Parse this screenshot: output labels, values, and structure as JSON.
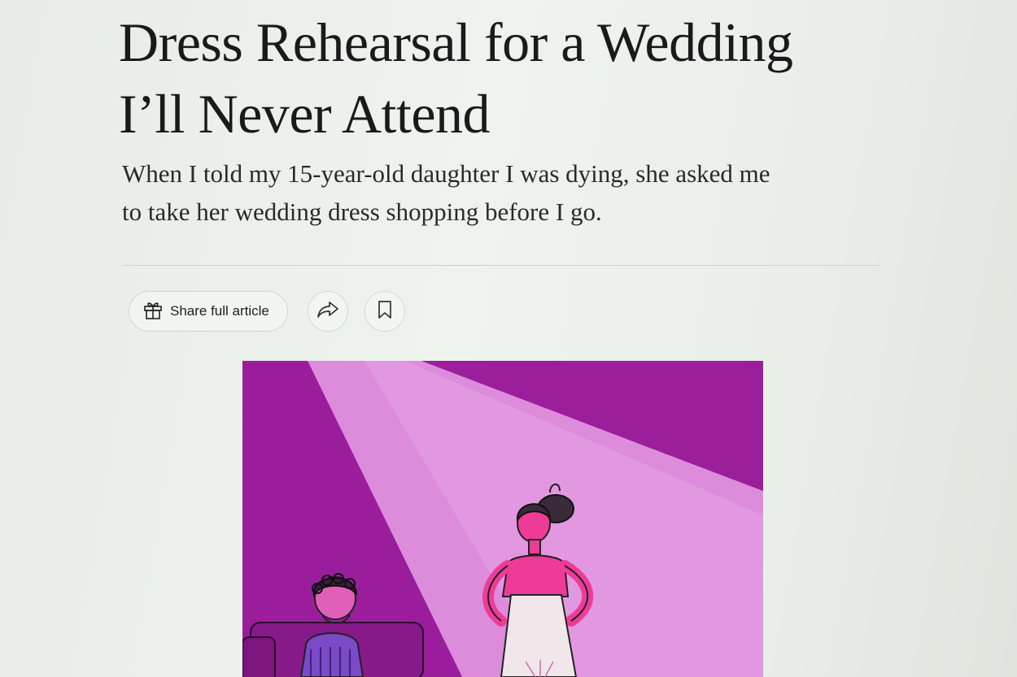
{
  "article": {
    "headline_line1": "Dress Rehearsal for a Wedding",
    "headline_line2": "I’ll Never Attend",
    "summary_line1": "When I told my 15-year-old daughter I was dying, she asked me",
    "summary_line2": "to take her wedding dress shopping before I go."
  },
  "share_bar": {
    "share_label": "Share full article",
    "icons": [
      "gift-icon",
      "share-arrow-icon",
      "bookmark-icon"
    ]
  },
  "illustration": {
    "colors": {
      "dark_magenta": "#9c1f9c",
      "mid_magenta": "#a628a8",
      "light_pink": "#dd8bdc",
      "pale_pink": "#e8a6e6",
      "dress": "#f1e6ea",
      "skin": "#ef3b98"
    }
  }
}
